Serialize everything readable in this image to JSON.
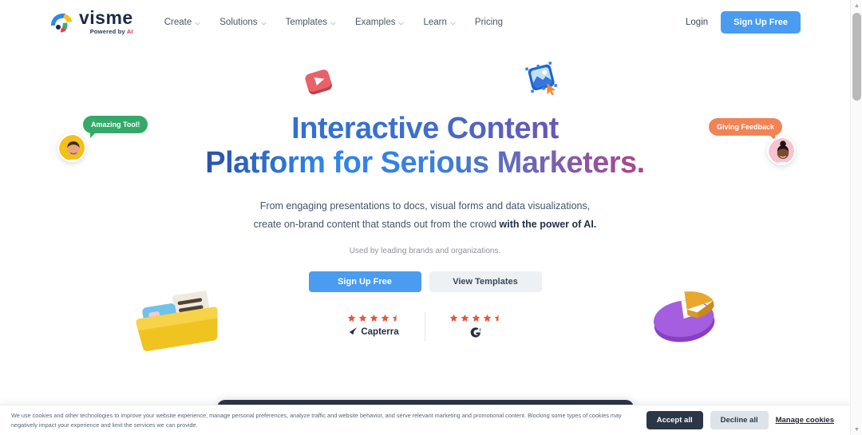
{
  "brand": {
    "name": "visme",
    "tagline_prefix": "Powered by ",
    "tagline_accent": "AI",
    "accent_blue": "#4a9cf0",
    "logo_icon": "visme-peacock-logo"
  },
  "header": {
    "nav": [
      {
        "label": "Create",
        "has_dropdown": true
      },
      {
        "label": "Solutions",
        "has_dropdown": true
      },
      {
        "label": "Templates",
        "has_dropdown": true
      },
      {
        "label": "Examples",
        "has_dropdown": true
      },
      {
        "label": "Learn",
        "has_dropdown": true
      },
      {
        "label": "Pricing",
        "has_dropdown": false
      }
    ],
    "login_label": "Login",
    "signup_label": "Sign Up Free"
  },
  "hero": {
    "headline_line1": "Interactive Content",
    "headline_line2": "Platform for Serious Marketers.",
    "subhead_line1": "From engaging presentations to docs, visual forms and data visualizations,",
    "subhead_line2_plain": "create on-brand content that stands out from the crowd ",
    "subhead_line2_bold": "with the power of AI.",
    "used_by": "Used by leading brands and organizations.",
    "cta_primary": "Sign Up Free",
    "cta_secondary": "View Templates"
  },
  "ratings": [
    {
      "brand": "Capterra",
      "icon": "capterra-icon",
      "stars": 4.5,
      "star_color": "#e8563c"
    },
    {
      "brand": "G2",
      "icon": "g2-icon",
      "stars": 4.5,
      "star_color": "#e8563c"
    }
  ],
  "decorations": {
    "bubble_left": {
      "text": "Amazing Tool!",
      "color": "#35a969",
      "avatar": "avatar-man-yellow"
    },
    "bubble_right": {
      "text": "Giving Feedback",
      "color": "#f08457",
      "avatar": "avatar-woman-pink"
    },
    "float_play": "play-button-3d-icon",
    "float_image": "image-placeholder-3d-icon",
    "float_folder": "folder-documents-3d-icon",
    "float_pie": "pie-chart-3d-icon"
  },
  "cookie_banner": {
    "text": "We use cookies and other technologies to improve your website experience, manage personal preferences, analyze traffic and website behavior, and serve relevant marketing and promotional content. Blocking some types of cookies may negatively impact your experience and limit the services we can provide.",
    "accept_label": "Accept all",
    "decline_label": "Decline all",
    "manage_label": "Manage cookies"
  },
  "scrollbar": {
    "up_arrow": "▲",
    "down_arrow": "▼"
  }
}
